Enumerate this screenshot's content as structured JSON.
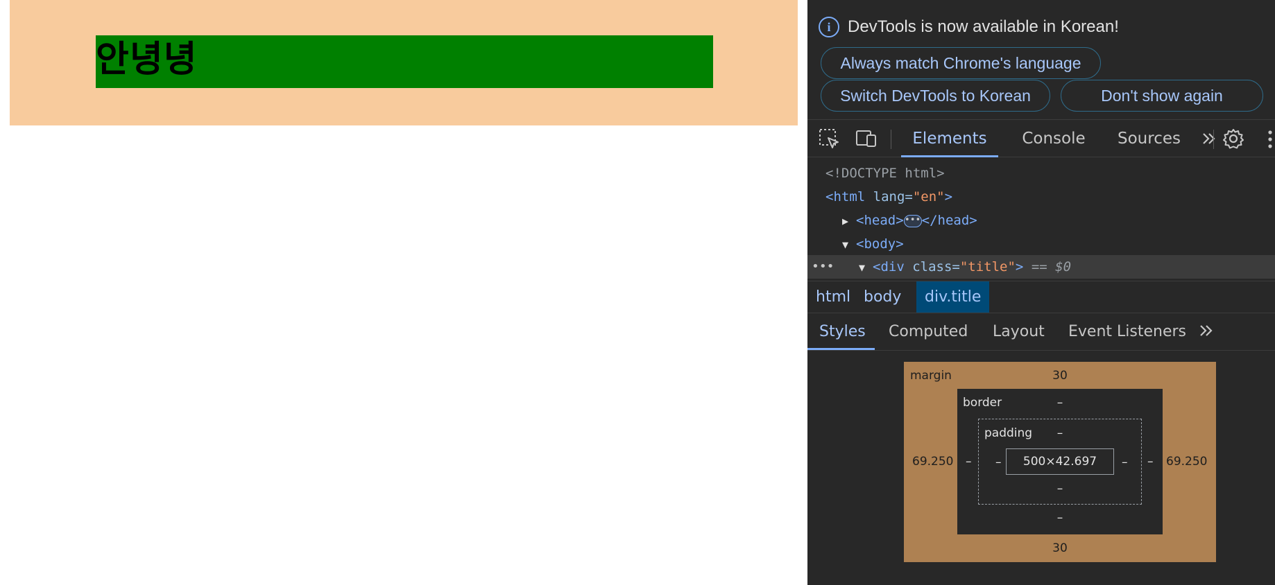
{
  "page": {
    "title_text": "안녕녕",
    "header_bg": "#f8cb9d",
    "title_bg": "#008000"
  },
  "devtools": {
    "infobar": {
      "icon": "info-icon",
      "message": "DevTools is now available in Korean!",
      "buttons": {
        "match": "Always match Chrome's language",
        "switch": "Switch DevTools to Korean",
        "dont_show": "Don't show again"
      }
    },
    "toolbar": {
      "icons": [
        "inspect-element-icon",
        "device-toolbar-icon",
        "more-tabs-icon",
        "settings-gear-icon",
        "kebab-menu-icon"
      ],
      "tabs": {
        "elements": "Elements",
        "console": "Console",
        "sources": "Sources"
      },
      "active_tab": "Elements"
    },
    "dom": {
      "doctype": "<!DOCTYPE html>",
      "html_tag_open": "<html ",
      "html_attr_name": "lang=",
      "html_attr_value": "\"en\"",
      "html_tag_close": ">",
      "head_open": "<head>",
      "head_ellipsis": "•••",
      "head_close": "</head>",
      "body_open": "<body>",
      "row_dots": "•••",
      "div_open": "<div ",
      "div_attr_name": "class=",
      "div_attr_value": "\"title\"",
      "div_close": ">",
      "selected_marker": "== $0"
    },
    "breadcrumbs": {
      "html": "html",
      "body": "body",
      "selected": "div.title"
    },
    "subtabs": {
      "styles": "Styles",
      "computed": "Computed",
      "layout": "Layout",
      "event_listeners": "Event Listeners",
      "active": "Styles"
    },
    "box_model": {
      "margin_label": "margin",
      "margin_top": "30",
      "margin_bottom": "30",
      "margin_left": "69.250",
      "margin_right": "69.250",
      "border_label": "border",
      "border_top": "–",
      "border_bottom": "–",
      "border_left": "–",
      "border_right": "–",
      "padding_label": "padding",
      "padding_top": "–",
      "padding_bottom": "–",
      "padding_left": "–",
      "padding_right": "–",
      "content_size": "500×42.697"
    }
  }
}
